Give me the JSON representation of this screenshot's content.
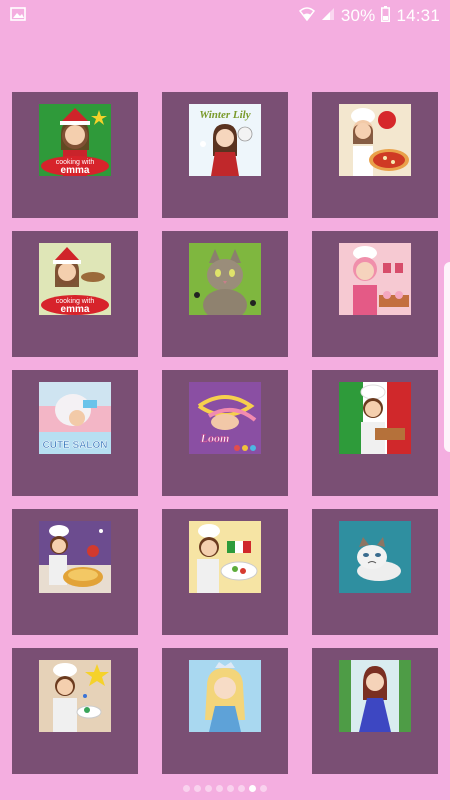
{
  "status_bar": {
    "battery_percent": "30%",
    "time": "14:31",
    "icons": [
      "image-notification-icon",
      "wifi-icon",
      "cellular-signal-icon",
      "battery-icon"
    ]
  },
  "games": [
    {
      "id": "cooking-with-emma-christmas-1",
      "art_text_1": "cooking with",
      "art_text_2": "emma"
    },
    {
      "id": "winter-lily",
      "art_text_1": "Winter Lily"
    },
    {
      "id": "cooking-pizza-girl"
    },
    {
      "id": "cooking-with-emma-christmas-2",
      "art_text_1": "cooking with",
      "art_text_2": "emma"
    },
    {
      "id": "cat-grooming"
    },
    {
      "id": "cooking-cupcake-girl"
    },
    {
      "id": "cute-salon",
      "art_text_1": "CUTE SALON"
    },
    {
      "id": "loom-bracelets",
      "art_text_1": "Loom"
    },
    {
      "id": "italian-chef"
    },
    {
      "id": "cooking-pie-girl"
    },
    {
      "id": "cooking-salad-girl"
    },
    {
      "id": "grumpy-cat"
    },
    {
      "id": "cooking-chef-stars"
    },
    {
      "id": "ice-princess"
    },
    {
      "id": "fairy-princess"
    }
  ],
  "pager": {
    "count": 8,
    "active_index": 6
  },
  "colors": {
    "background": "#f4aee0",
    "tile": "#7a4f74",
    "statusbar_text": "#ffffff"
  }
}
